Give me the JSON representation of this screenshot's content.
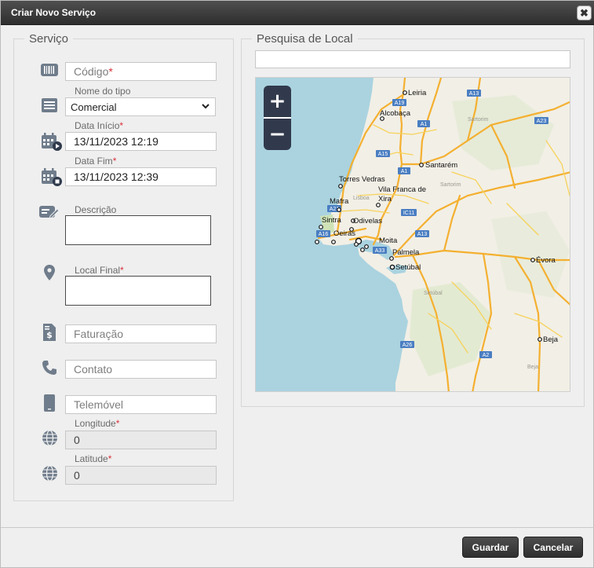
{
  "dialog": {
    "title": "Criar Novo Serviço",
    "close_glyph": "✖"
  },
  "servico": {
    "legend": "Serviço",
    "codigo": {
      "placeholder": "Código",
      "required": "*"
    },
    "tipo": {
      "label": "Nome do tipo",
      "value": "Comercial"
    },
    "data_inicio": {
      "label": "Data Início",
      "required": "*",
      "value": "13/11/2023 12:19"
    },
    "data_fim": {
      "label": "Data Fim",
      "required": "*",
      "value": "13/11/2023 12:39"
    },
    "descricao": {
      "label": "Descrição"
    },
    "local_final": {
      "label": "Local Final",
      "required": "*"
    },
    "faturacao": {
      "placeholder": "Faturação"
    },
    "contato": {
      "placeholder": "Contato"
    },
    "telemovel": {
      "placeholder": "Telemóvel"
    },
    "longitude": {
      "label": "Longitude",
      "required": "*",
      "value": "0"
    },
    "latitude": {
      "label": "Latitude",
      "required": "*",
      "value": "0"
    }
  },
  "pesquisa": {
    "legend": "Pesquisa de Local",
    "search_value": "",
    "zoom_in": "+",
    "zoom_out": "−",
    "cities": {
      "leiria": "Leiria",
      "alcobaca": "Alcobaça",
      "santarem": "Santarém",
      "torres_vedras": "Torres Vedras",
      "vila_franca_1": "Vila Franca de",
      "vila_franca_2": "Xira",
      "mafra": "Mafra",
      "sintra": "Sintra",
      "odivelas": "Odivelas",
      "oeiras": "Oeiras",
      "moita": "Moita",
      "palmela": "Palmela",
      "setubal": "Setúbal",
      "evora": "Évora",
      "beja": "Beja"
    },
    "faint": {
      "sartorim": "Sartorim",
      "sartorim2": "Sartorim",
      "lisboa": "Lisboa",
      "setubal_region": "Setúbal",
      "beja_region": "Beja"
    },
    "roads": {
      "a19": "A19",
      "a13_top": "A13",
      "a1_top": "A1",
      "a23": "A23",
      "a15": "A15",
      "a1_mid": "A1",
      "a21": "A21",
      "ic11": "IC11",
      "a16": "A16",
      "a13_mid": "A13",
      "a33": "A33",
      "a26": "A26",
      "a2": "A2"
    }
  },
  "footer": {
    "save": "Guardar",
    "cancel": "Cancelar"
  }
}
